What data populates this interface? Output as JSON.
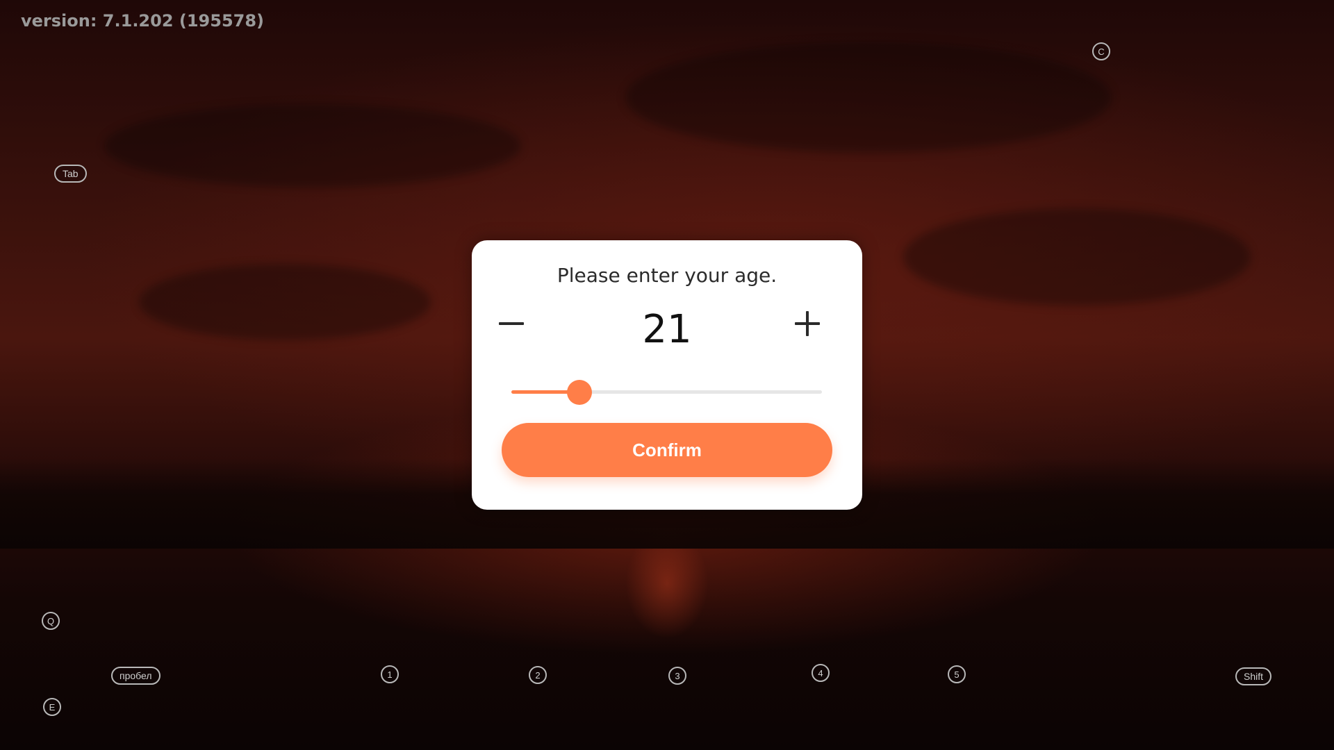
{
  "version_label": "version: 7.1.202 (195578)",
  "dialog": {
    "title": "Please enter your age.",
    "age_value": "21",
    "decrement_icon": "minus-icon",
    "increment_icon": "plus-icon",
    "slider_fraction": 0.22,
    "confirm_label": "Confirm"
  },
  "key_hints": {
    "tab": "Tab",
    "c": "C",
    "q": "Q",
    "space": "пробел",
    "e": "E",
    "n1": "1",
    "n2": "2",
    "n3": "3",
    "n4": "4",
    "n5": "5",
    "shift": "Shift"
  },
  "colors": {
    "accent": "#ff7e48",
    "modal_bg": "#ffffff"
  }
}
